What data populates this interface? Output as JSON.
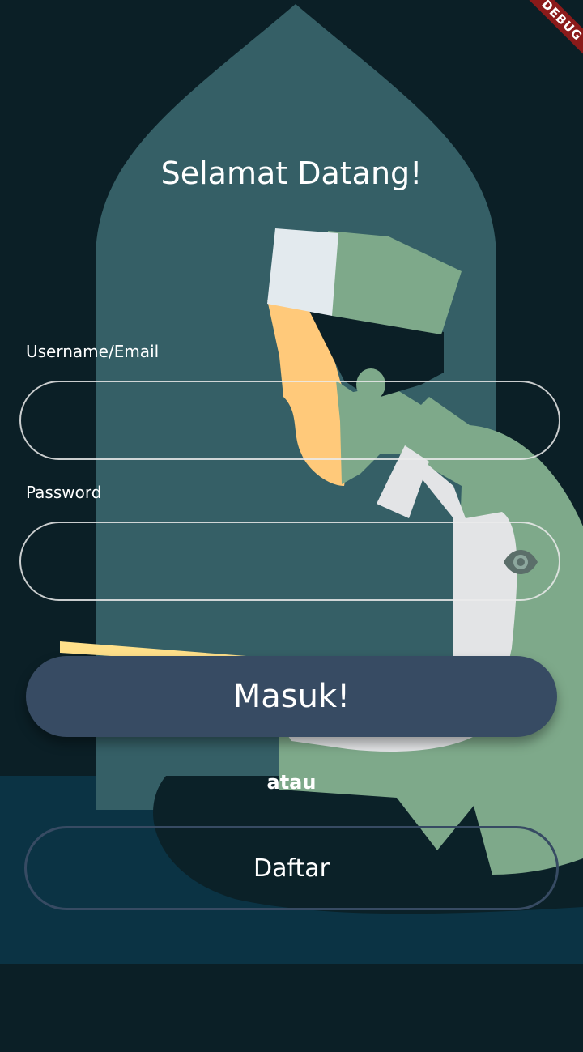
{
  "debug_banner": "DEBUG",
  "header": {
    "title": "Selamat Datang!"
  },
  "form": {
    "username_label": "Username/Email",
    "username_value": "",
    "password_label": "Password",
    "password_value": "",
    "password_toggle_icon": "eye-icon",
    "submit_label": "Masuk!",
    "separator": "atau",
    "register_label": "Daftar"
  },
  "colors": {
    "background": "#0b1f26",
    "arch": "#355f66",
    "primary_button": "#374b63",
    "figure_green": "#7ea98a",
    "cap_white": "#e3eaee",
    "skin": "#ffc97a",
    "floor": "#0b3344"
  }
}
